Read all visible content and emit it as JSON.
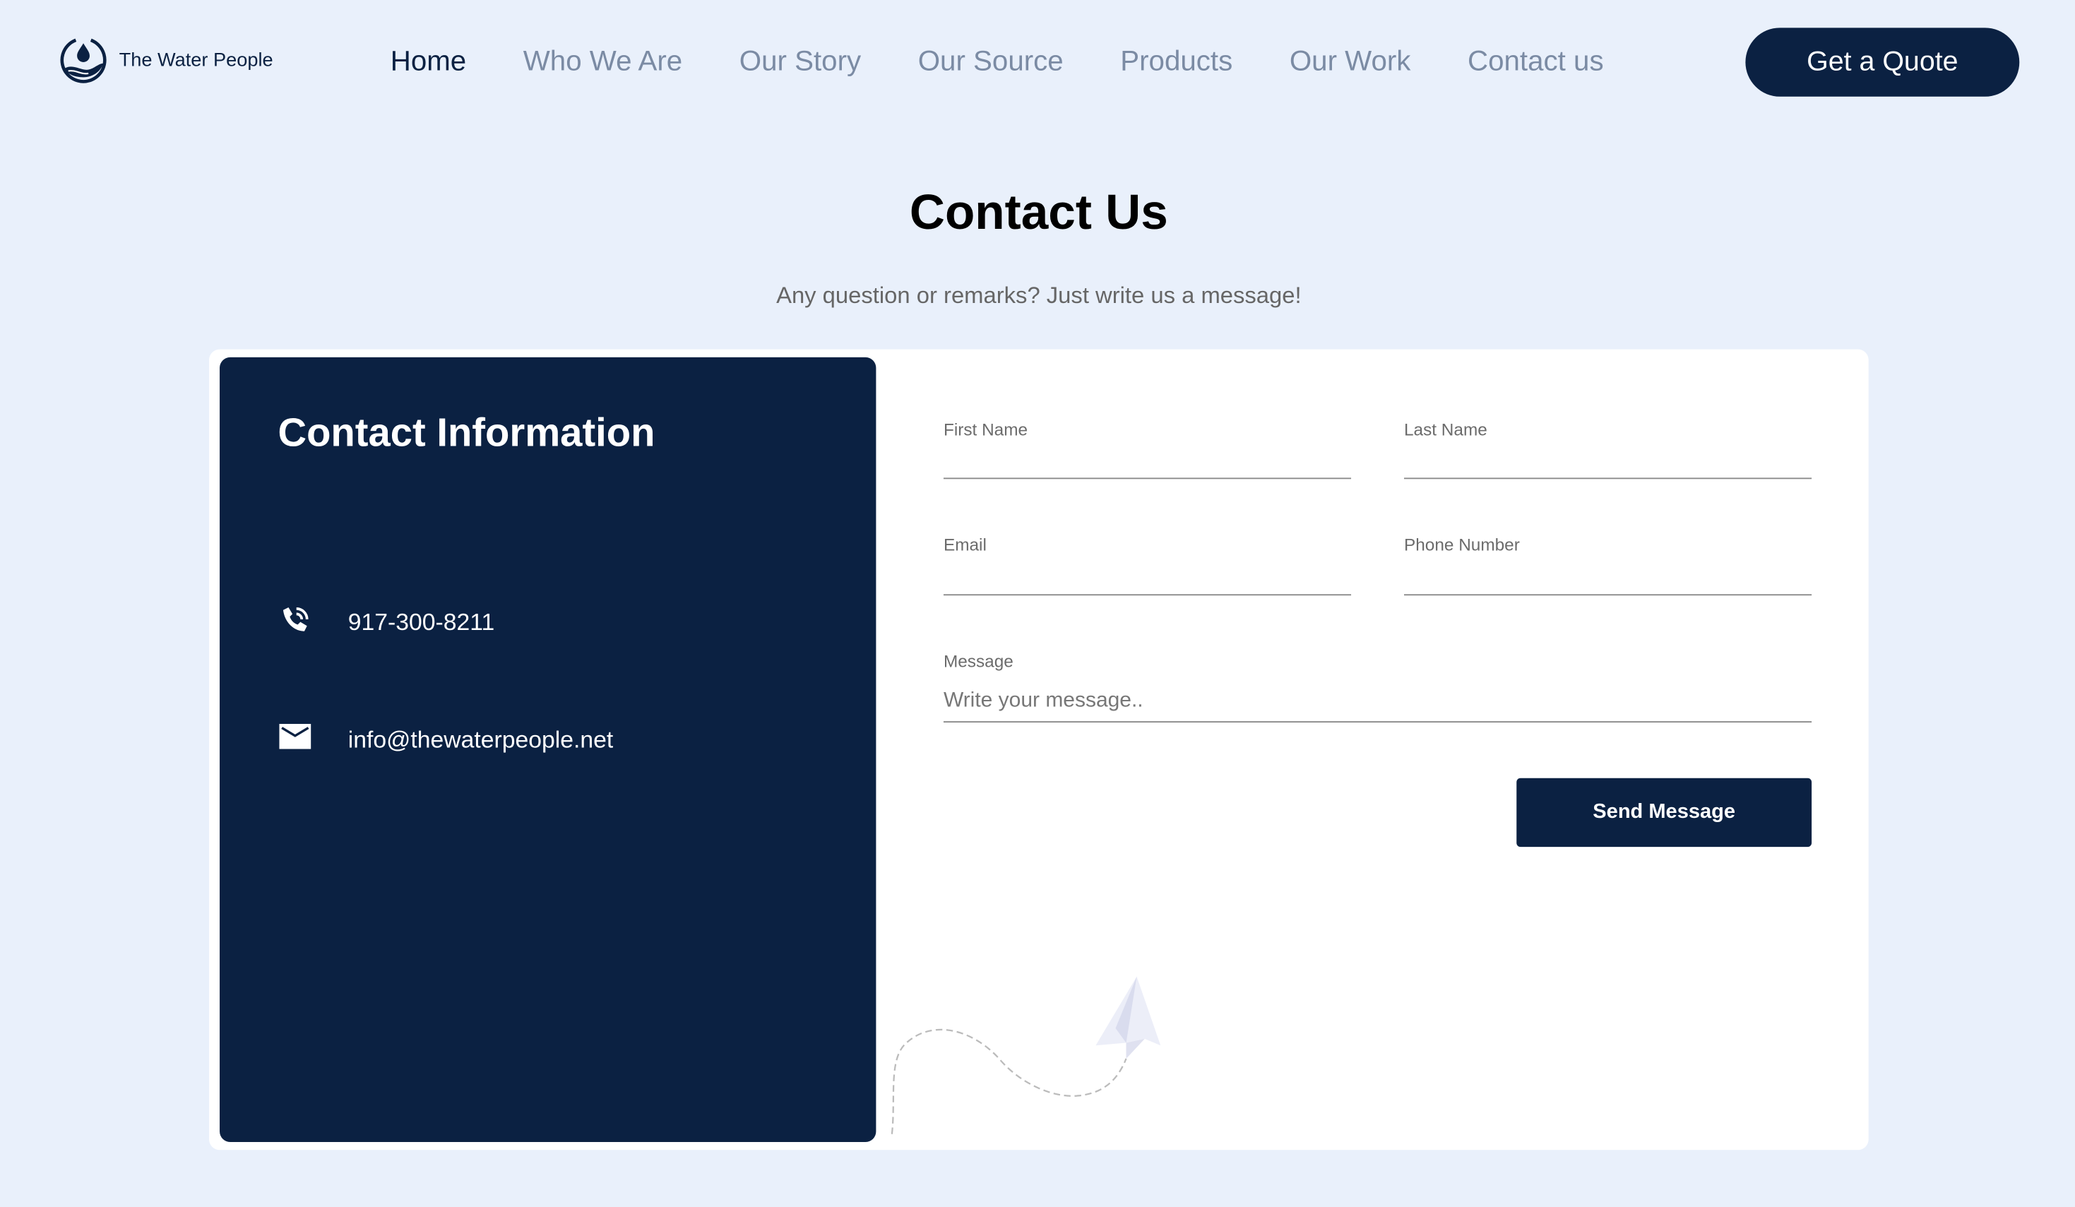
{
  "header": {
    "brand": "The Water People",
    "nav": [
      "Home",
      "Who We Are",
      "Our Story",
      "Our Source",
      "Products",
      "Our Work",
      "Contact us"
    ],
    "active": "Home",
    "cta": "Get a Quote"
  },
  "page": {
    "title": "Contact Us",
    "subtitle": "Any question or remarks? Just write us a message!"
  },
  "info": {
    "title": "Contact Information",
    "phone": "917-300-8211",
    "email": "info@thewaterpeople.net"
  },
  "form": {
    "first_name_label": "First Name",
    "last_name_label": "Last Name",
    "email_label": "Email",
    "phone_label": "Phone Number",
    "message_label": "Message",
    "message_placeholder": "Write your message..",
    "submit": "Send Message"
  },
  "colors": {
    "brand": "#0b2142",
    "background": "#e9f0fb",
    "nav_inactive": "#7b8ba4"
  }
}
